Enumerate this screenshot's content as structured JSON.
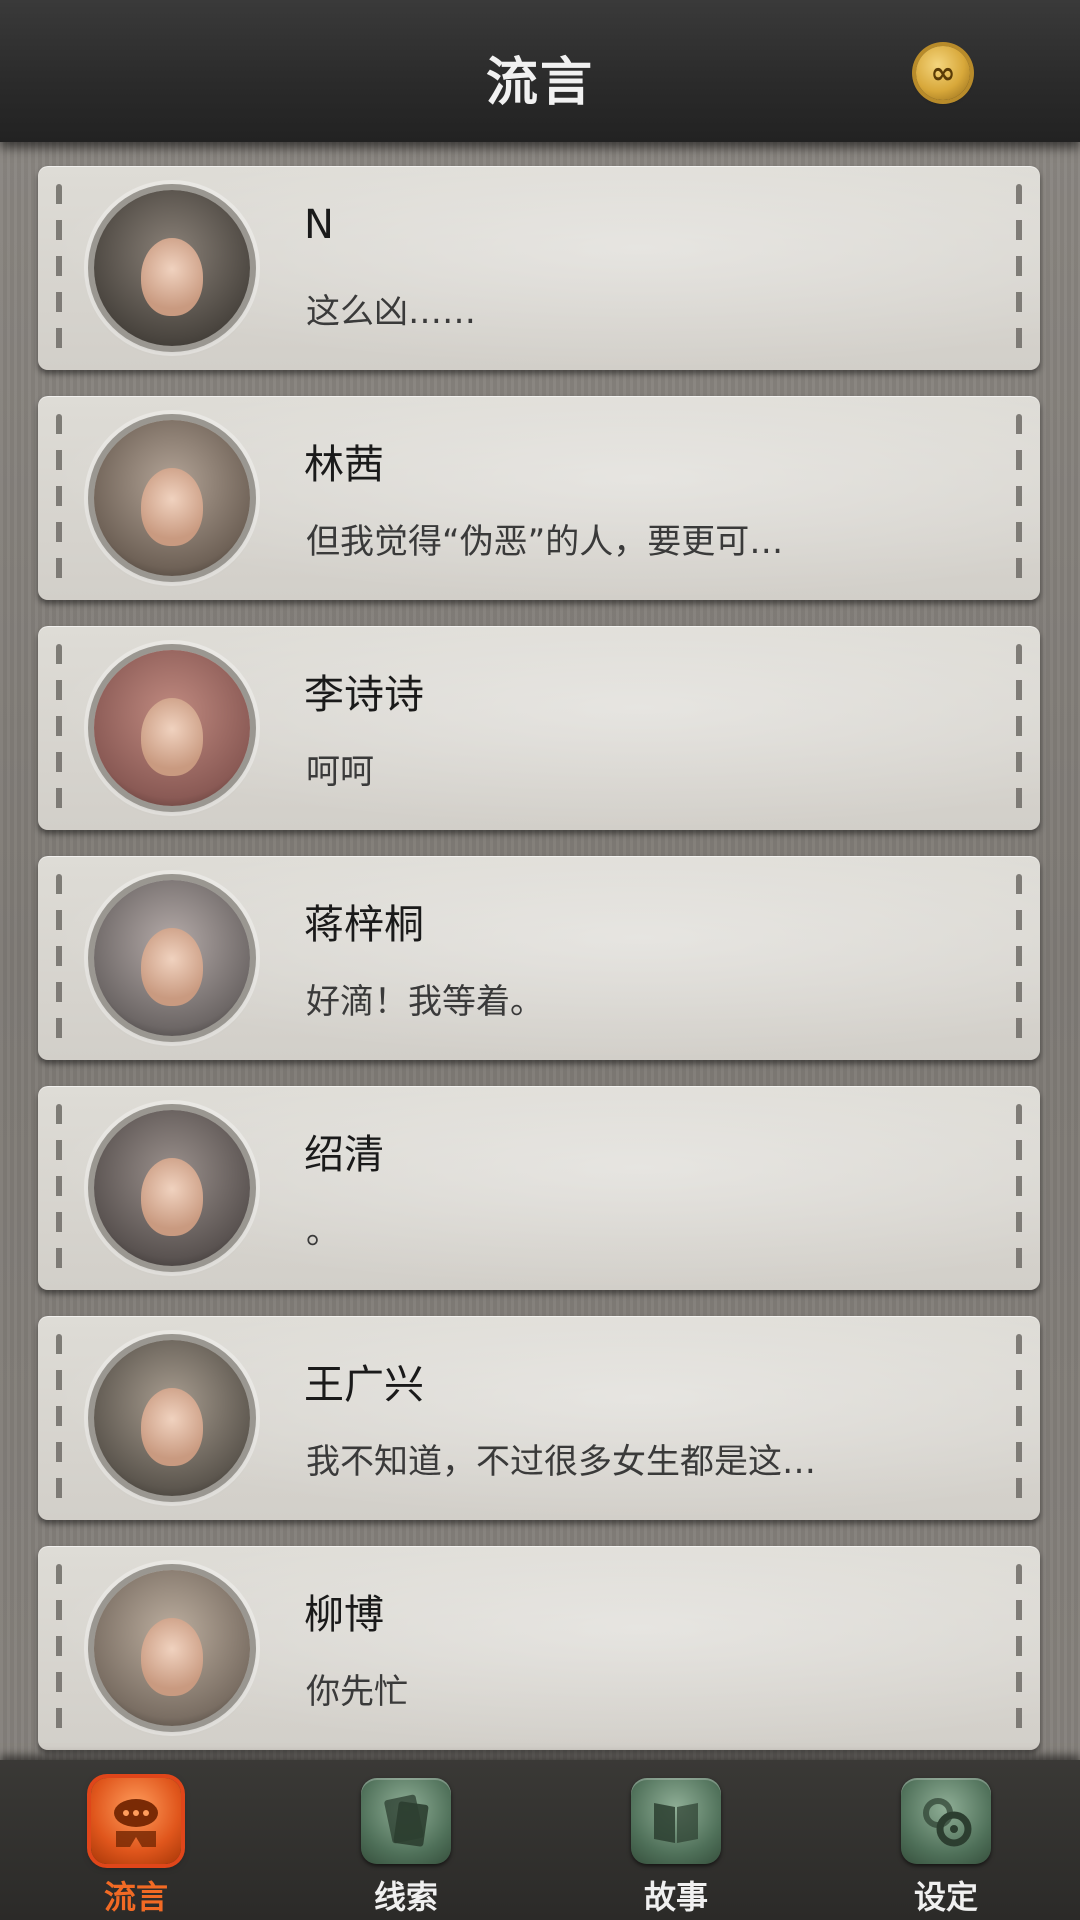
{
  "header": {
    "title": "流言",
    "coin_symbol": "∞"
  },
  "conversations": [
    {
      "name": "N",
      "message": "这么凶……",
      "avatar_tone": "#4b4640"
    },
    {
      "name": "林茜",
      "message": "但我觉得“伪恶”的人，要更可…",
      "avatar_tone": "#6f6257"
    },
    {
      "name": "李诗诗",
      "message": "呵呵",
      "avatar_tone": "#8a5a55"
    },
    {
      "name": "蒋梓桐",
      "message": "好滴！我等着。",
      "avatar_tone": "#6d6766"
    },
    {
      "name": "绍清",
      "message": "。",
      "avatar_tone": "#5a5351"
    },
    {
      "name": "王广兴",
      "message": "我不知道，不过很多女生都是这…",
      "avatar_tone": "#5d574f"
    },
    {
      "name": "柳博",
      "message": "你先忙",
      "avatar_tone": "#7a6e63"
    }
  ],
  "bottom_nav": [
    {
      "label": "流言",
      "icon": "rumor-chat-icon",
      "active": true
    },
    {
      "label": "线索",
      "icon": "clue-papers-icon",
      "active": false
    },
    {
      "label": "故事",
      "icon": "story-book-icon",
      "active": false
    },
    {
      "label": "设定",
      "icon": "settings-gear-icon",
      "active": false
    }
  ]
}
